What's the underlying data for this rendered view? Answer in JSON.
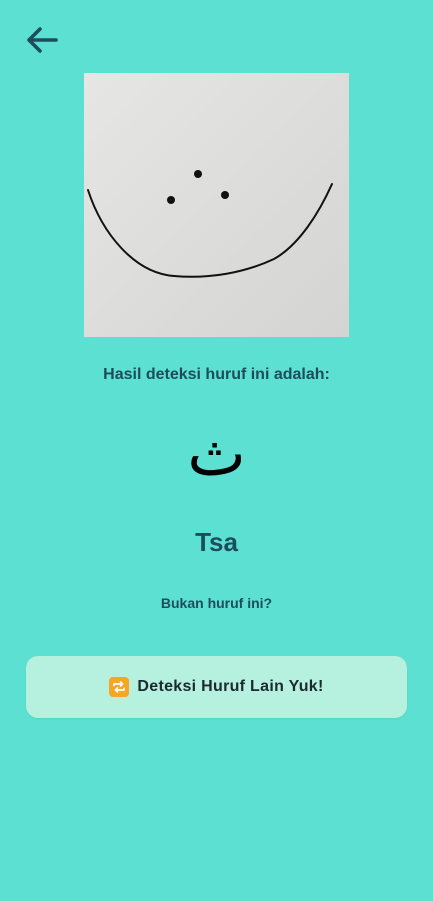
{
  "header": {
    "back_icon": "arrow-left-icon"
  },
  "photo": {
    "description_icon": "captured-drawing-image"
  },
  "result": {
    "label": "Hasil deteksi huruf ini adalah:",
    "arabic_letter": "ث",
    "letter_name": "Tsa",
    "wrong_prompt": "Bukan huruf ini?"
  },
  "retry_button": {
    "icon": "repeat-icon",
    "label": "Deteksi Huruf Lain Yuk!"
  },
  "colors": {
    "background": "#5ce0d1",
    "text_primary": "#1d4d5c",
    "button_bg": "#b6f0de",
    "icon_accent": "#f5a623"
  }
}
